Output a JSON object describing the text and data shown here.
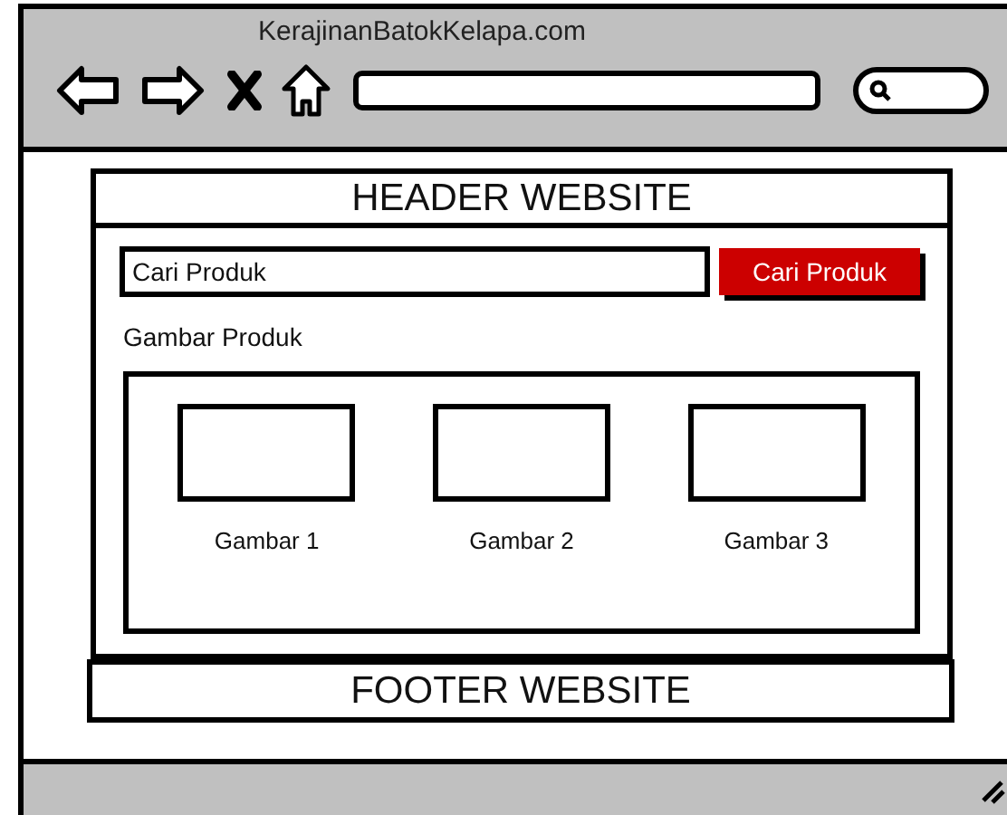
{
  "window": {
    "title": "KerajinanBatokKelapa.com"
  },
  "header": {
    "title": "HEADER WEBSITE"
  },
  "search": {
    "value": "Cari Produk",
    "button": "Cari Produk"
  },
  "gallery": {
    "title": "Gambar Produk",
    "items": [
      {
        "label": "Gambar 1"
      },
      {
        "label": "Gambar 2"
      },
      {
        "label": "Gambar 3"
      }
    ]
  },
  "footer": {
    "title": "FOOTER WEBSITE"
  }
}
